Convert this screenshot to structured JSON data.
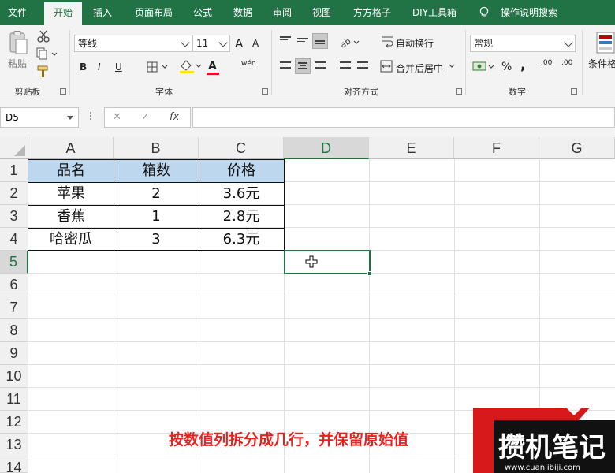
{
  "menu": {
    "tabs": [
      {
        "label": "文件"
      },
      {
        "label": "开始"
      },
      {
        "label": "插入"
      },
      {
        "label": "页面布局"
      },
      {
        "label": "公式"
      },
      {
        "label": "数据"
      },
      {
        "label": "审阅"
      },
      {
        "label": "视图"
      },
      {
        "label": "方方格子"
      },
      {
        "label": "DIY工具箱"
      }
    ],
    "active_index": 1,
    "tell_me": "操作说明搜索"
  },
  "ribbon": {
    "clipboard": {
      "paste_label": "粘贴",
      "group_label": "剪贴板"
    },
    "font": {
      "font_name": "等线",
      "font_size": "11",
      "bold": "B",
      "italic": "I",
      "underline": "U",
      "font_color": "A",
      "pinyin": "wén",
      "group_label": "字体",
      "increase_font": "A",
      "decrease_font": "A"
    },
    "alignment": {
      "wrap_text": "自动换行",
      "merge_center": "合并后居中",
      "group_label": "对齐方式"
    },
    "number": {
      "format": "常规",
      "percent": "%",
      "comma": ",",
      "inc_decimal": ".00",
      "dec_decimal": ".00",
      "group_label": "数字"
    },
    "styles": {
      "conditional_format": "条件格"
    }
  },
  "formula_bar": {
    "name_box": "D5",
    "cancel": "✕",
    "confirm": "✓",
    "fx": "fx",
    "value": ""
  },
  "columns": [
    "A",
    "B",
    "C",
    "D",
    "E",
    "F",
    "G"
  ],
  "rows": [
    "1",
    "2",
    "3",
    "4",
    "5",
    "6",
    "7",
    "8",
    "9",
    "10",
    "11",
    "12",
    "13",
    "14"
  ],
  "selected_cell": {
    "column": "D",
    "row": "5"
  },
  "table": {
    "headers": [
      "品名",
      "箱数",
      "价格"
    ],
    "rows": [
      [
        "苹果",
        "2",
        "3.6元"
      ],
      [
        "香蕉",
        "1",
        "2.8元"
      ],
      [
        "哈密瓜",
        "3",
        "6.3元"
      ]
    ],
    "header_fill": "#BDD7EE"
  },
  "caption": "按数值列拆分成几行，并保留原始值",
  "watermark": {
    "brand": "攒机笔记",
    "url": "www.cuanjibiji.com"
  },
  "colors": {
    "accent": "#217346",
    "caption": "#E8201E",
    "logo_red": "#D7191B"
  }
}
